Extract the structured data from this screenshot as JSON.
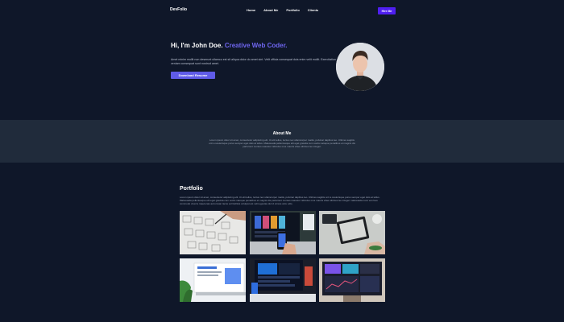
{
  "nav": {
    "logo": "DevFolio",
    "links": [
      "Home",
      "About Me",
      "Portfolio",
      "Clients"
    ],
    "cta": "Hire Me"
  },
  "hero": {
    "title_plain": "Hi, I'm John Doe.",
    "title_accent": "Creative Web Coder.",
    "description": "Amet minim mollit non deserunt ullamco est sit aliqua dolor do amet sint. Velit officia consequat duis enim velit mollit. Exercitation veniam consequat sunt nostrud amet.",
    "button": "Download Resume"
  },
  "about": {
    "title": "About Me",
    "text": "Lorem ipsum dolor sit amet, consectetur adipiscing elit. Ut elit tellus, luctus nec ullamcorper mattis, pulvinar dapibus leo. Ultrices sagittis orci a scelerisque purus semper eget duis at tellus. Malesuada pellentesque elit eget gravida cum sociis natoque penatibus et magnis dis parturient montes nascetur ridiculus mus mauris vitae ultricies leo integer."
  },
  "portfolio": {
    "title": "Portfolio",
    "description": "Lorem ipsum dolor sit amet, consectetur adipiscing elit. Ut elit tellus, luctus nec ullamcorper mattis, pulvinar dapibus leo. Ultrices sagittis orci a scelerisque purus semper eget duis at tellus. Malesuada pellentesque elit eget gravida cum sociis natoque penatibus et magnis dis parturient montes nascetur ridiculus mus mauris vitae ultricies leo integer malesuada nunc vel risus commodo viverra maecenas accumsan lacus vel facilisis volutpat est velit egestas dui id ornare arcu odio.",
    "items": [
      {
        "name": "wireframe-sketches"
      },
      {
        "name": "mobile-app-on-laptop"
      },
      {
        "name": "tablet-on-desk"
      },
      {
        "name": "laptop-web-design"
      },
      {
        "name": "dashboard-monitor"
      },
      {
        "name": "desktop-ui-screen"
      }
    ]
  },
  "colors": {
    "background": "#0f1729",
    "accent": "#6f66f0",
    "cta": "#4f1ff0",
    "section_band": "#202b3b"
  }
}
